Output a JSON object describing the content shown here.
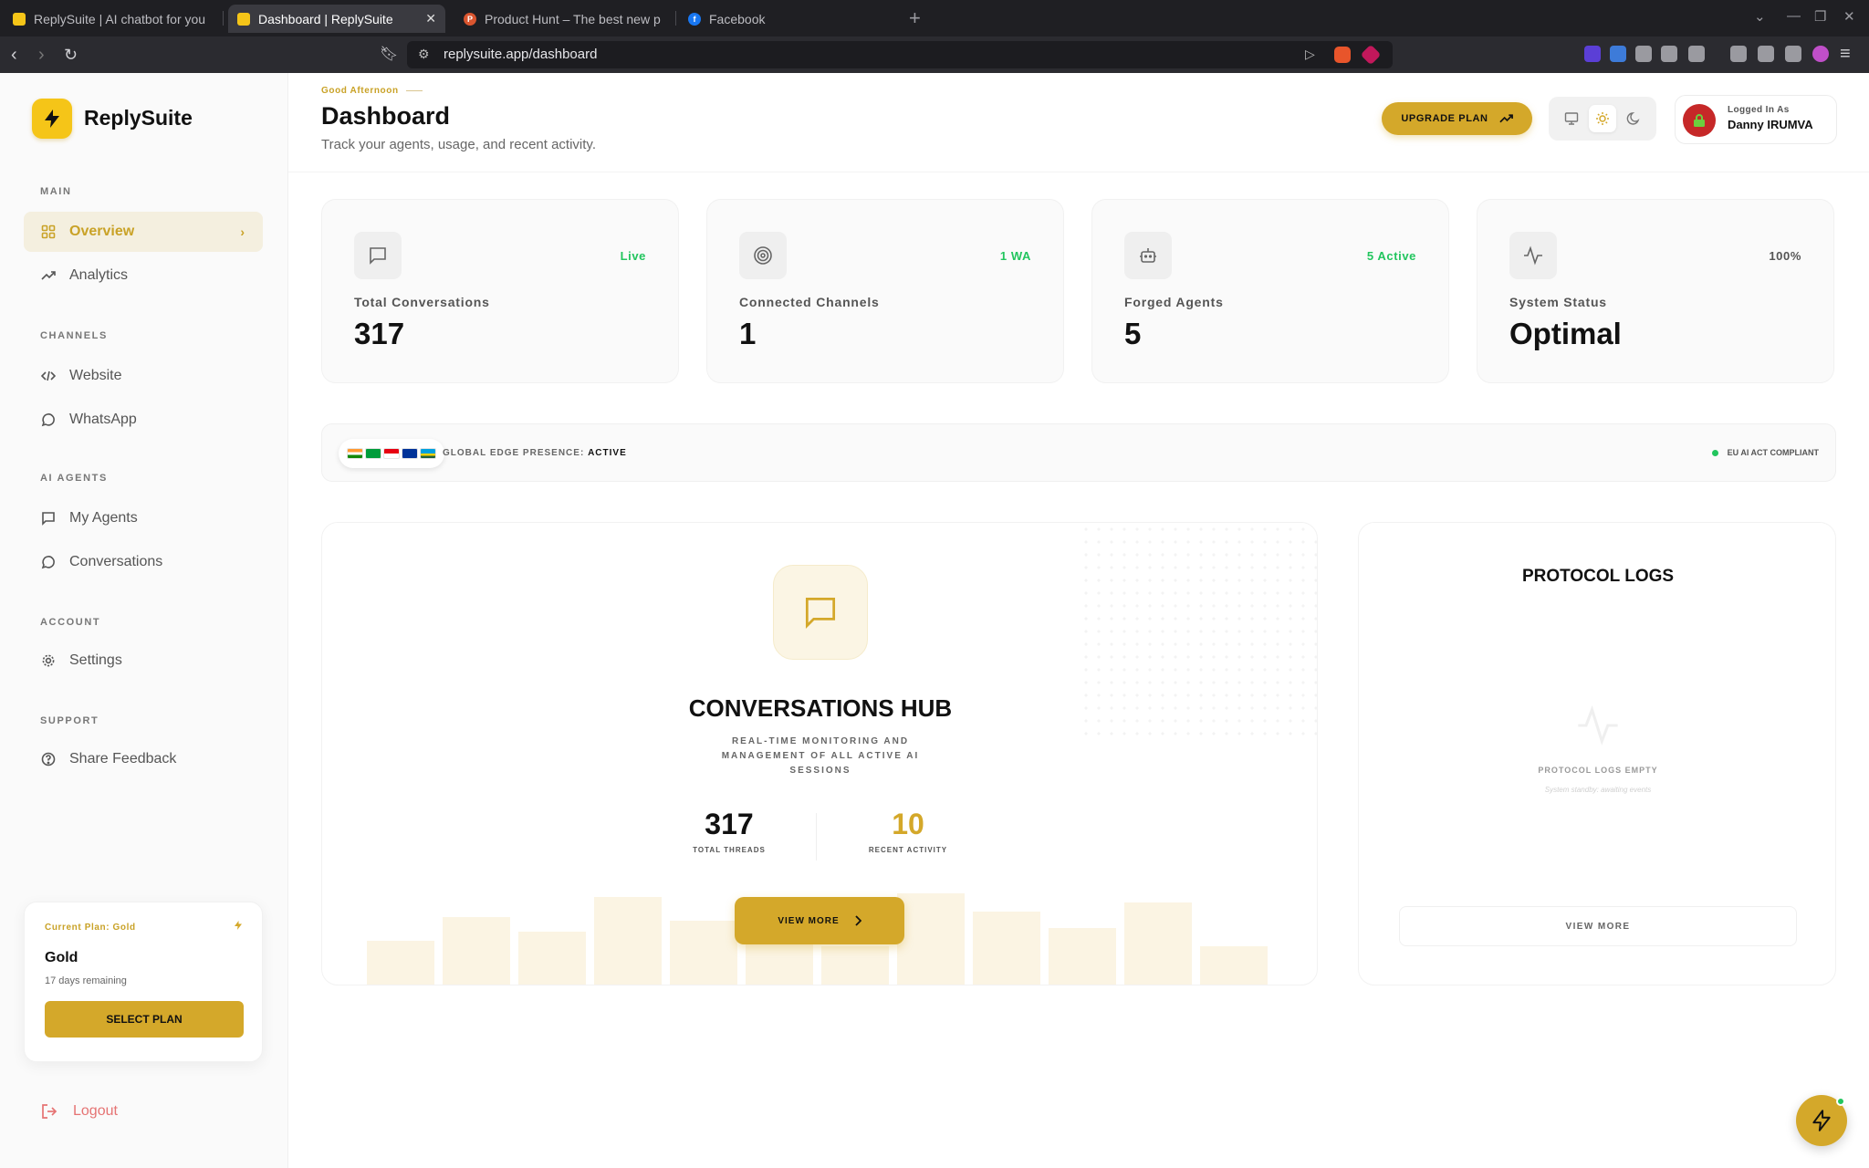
{
  "browser": {
    "tabs": [
      {
        "title": "ReplySuite | AI chatbot for you",
        "active": false,
        "favicon_color": "#f5c518"
      },
      {
        "title": "Dashboard | ReplySuite",
        "active": true,
        "favicon_color": "#f5c518"
      },
      {
        "title": "Product Hunt – The best new p",
        "active": false,
        "favicon_color": "#da552f"
      },
      {
        "title": "Facebook",
        "active": false,
        "favicon_color": "#1877f2"
      }
    ],
    "url": "replysuite.app/dashboard"
  },
  "sidebar": {
    "brand": "ReplySuite",
    "sections": {
      "main": "MAIN",
      "channels": "CHANNELS",
      "ai_agents": "AI AGENTS",
      "account": "ACCOUNT",
      "support": "SUPPORT"
    },
    "items": {
      "overview": "Overview",
      "analytics": "Analytics",
      "website": "Website",
      "whatsapp": "WhatsApp",
      "my_agents": "My Agents",
      "conversations": "Conversations",
      "settings": "Settings",
      "share_feedback": "Share Feedback"
    },
    "plan": {
      "label": "Current Plan: Gold",
      "name": "Gold",
      "remaining": "17 days remaining",
      "button": "SELECT PLAN"
    },
    "logout": "Logout"
  },
  "header": {
    "greeting": "Good Afternoon",
    "title": "Dashboard",
    "subtitle": "Track your agents, usage, and recent activity.",
    "upgrade": "UPGRADE PLAN",
    "user_label": "Logged In As",
    "user_name": "Danny IRUMVA"
  },
  "stats": [
    {
      "label": "Total Conversations",
      "value": "317",
      "badge": "Live",
      "badge_color": "#22c55e",
      "icon": "chat-icon"
    },
    {
      "label": "Connected Channels",
      "value": "1",
      "badge": "1 WA",
      "badge_color": "#22c55e",
      "icon": "target-icon"
    },
    {
      "label": "Forged Agents",
      "value": "5",
      "badge": "5 Active",
      "badge_color": "#22c55e",
      "icon": "robot-icon"
    },
    {
      "label": "System Status",
      "value": "Optimal",
      "badge": "100%",
      "badge_color": "#555555",
      "icon": "activity-icon"
    }
  ],
  "edge": {
    "label": "GLOBAL EDGE PRESENCE:",
    "status": "ACTIVE",
    "compliance": "EU AI ACT COMPLIANT"
  },
  "hub": {
    "title": "CONVERSATIONS HUB",
    "subtitle": "REAL-TIME MONITORING AND MANAGEMENT OF ALL ACTIVE AI SESSIONS",
    "total_threads": "317",
    "total_threads_label": "TOTAL THREADS",
    "recent_activity": "10",
    "recent_activity_label": "RECENT ACTIVITY",
    "button": "VIEW MORE"
  },
  "logs": {
    "title": "PROTOCOL LOGS",
    "empty": "PROTOCOL LOGS EMPTY",
    "standby": "System standby: awaiting events",
    "button": "VIEW MORE"
  },
  "colors": {
    "accent": "#d4a82a",
    "brand_yellow": "#f5c518",
    "success": "#22c55e",
    "danger": "#e57373"
  }
}
